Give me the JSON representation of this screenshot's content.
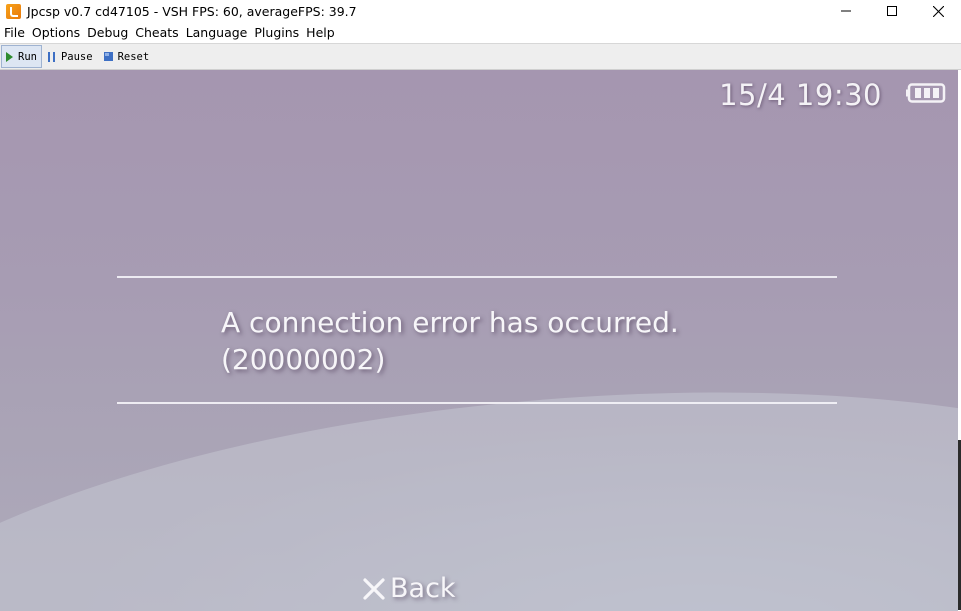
{
  "window": {
    "title": "Jpcsp v0.7 cd47105 - VSH FPS: 60, averageFPS: 39.7"
  },
  "menu": {
    "items": [
      "File",
      "Options",
      "Debug",
      "Cheats",
      "Language",
      "Plugins",
      "Help"
    ]
  },
  "toolbar": {
    "run_label": "Run",
    "pause_label": "Pause",
    "reset_label": "Reset"
  },
  "screen": {
    "clock": "15/4 19:30",
    "battery_icon": "battery-full-icon",
    "error_line1": "A connection error has occurred.",
    "error_line2": "(20000002)",
    "back_label": "Back",
    "back_icon": "cross-icon"
  },
  "colors": {
    "run_icon": "#2e8b2e",
    "reset_icon": "#3d6fc4"
  }
}
